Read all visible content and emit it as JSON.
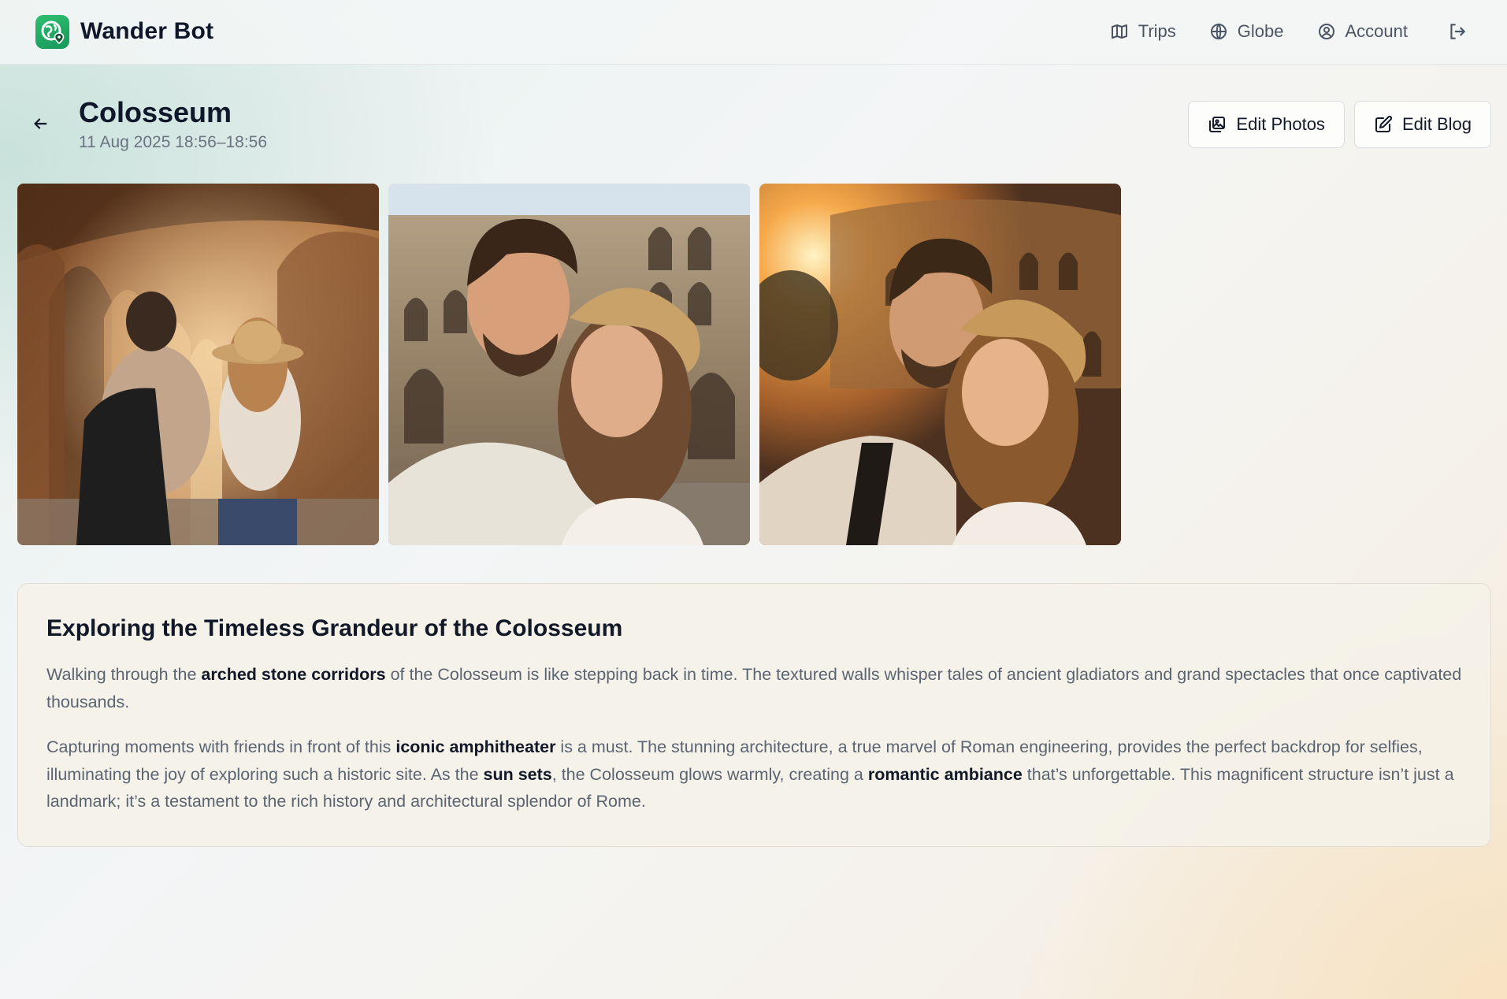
{
  "app": {
    "name": "Wander Bot",
    "logo_icon": "globe-pin-logo"
  },
  "nav": {
    "items": [
      {
        "label": "Trips",
        "icon": "map-icon"
      },
      {
        "label": "Globe",
        "icon": "globe-icon"
      },
      {
        "label": "Account",
        "icon": "user-circle-icon"
      }
    ],
    "logout_icon": "logout-icon"
  },
  "page": {
    "title": "Colosseum",
    "subtitle": "11 Aug 2025 18:56–18:56"
  },
  "actions": {
    "edit_photos": "Edit Photos",
    "edit_blog": "Edit Blog"
  },
  "photos": [
    {
      "name": "Couple walking through Colosseum arched corridors"
    },
    {
      "name": "Couple selfie in front of Colosseum"
    },
    {
      "name": "Couple selfie at Colosseum at sunset"
    }
  ],
  "blog": {
    "title": "Exploring the Timeless Grandeur of the Colosseum",
    "p1": {
      "t1": "Walking through the ",
      "b1": "arched stone corridors",
      "t2": " of the Colosseum is like stepping back in time. The textured walls whisper tales of ancient gladiators and grand spectacles that once captivated thousands."
    },
    "p2": {
      "t1": "Capturing moments with friends in front of this ",
      "b1": "iconic amphitheater",
      "t2": " is a must. The stunning architecture, a true marvel of Roman engineering, provides the perfect backdrop for selfies, illuminating the joy of exploring such a historic site. As the ",
      "b2": "sun sets",
      "t3": ", the Colosseum glows warmly, creating a ",
      "b3": "romantic ambiance",
      "t4": " that’s unforgettable. This magnificent structure isn’t just a landmark; it’s a testament to the rich history and architectural splendor of Rome."
    }
  },
  "colors": {
    "brand_green": "#1fa463",
    "text_dark": "#111827",
    "text_muted": "#5b6472"
  }
}
